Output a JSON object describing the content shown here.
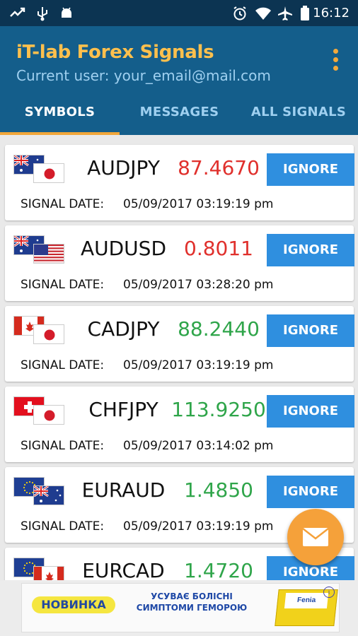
{
  "status_bar": {
    "time": "16:12"
  },
  "app": {
    "title": "iT-lab Forex Signals",
    "subtitle": "Current user: your_email@mail.com"
  },
  "tabs": [
    {
      "label": "SYMBOLS",
      "active": true
    },
    {
      "label": "MESSAGES",
      "active": false
    },
    {
      "label": "ALL SIGNALS",
      "active": false
    }
  ],
  "signal_date_label": "SIGNAL DATE:",
  "ignore_label": "IGNORE",
  "signals": [
    {
      "symbol": "AUDJPY",
      "price": "87.4670",
      "direction_color": "#e0302c",
      "flags": [
        "australia",
        "japan"
      ],
      "date": "05/09/2017 03:19:19 pm"
    },
    {
      "symbol": "AUDUSD",
      "price": "0.8011",
      "direction_color": "#e0302c",
      "flags": [
        "australia",
        "usa"
      ],
      "date": "05/09/2017 03:28:20 pm"
    },
    {
      "symbol": "CADJPY",
      "price": "88.2440",
      "direction_color": "#2fa54a",
      "flags": [
        "canada",
        "japan"
      ],
      "date": "05/09/2017 03:19:19 pm"
    },
    {
      "symbol": "CHFJPY",
      "price": "113.9250",
      "direction_color": "#2fa54a",
      "flags": [
        "switzerland",
        "japan"
      ],
      "date": "05/09/2017 03:14:02 pm"
    },
    {
      "symbol": "EURAUD",
      "price": "1.4850",
      "direction_color": "#2fa54a",
      "flags": [
        "eu",
        "australia"
      ],
      "date": "05/09/2017 03:19:19 pm"
    },
    {
      "symbol": "EURCAD",
      "price": "1.4720",
      "direction_color": "#2fa54a",
      "flags": [
        "eu",
        "canada"
      ],
      "date": ""
    }
  ],
  "ad": {
    "badge": "НОВИНКА",
    "line1": "УСУВАЄ БОЛІСНІ",
    "line2": "СИМПТОМИ ГЕМОРОЮ",
    "product": "Fenia"
  },
  "colors": {
    "app_bar": "#145e8b",
    "status_bar": "#0c3452",
    "title": "#ffc04d",
    "accent": "#f0a63a",
    "button": "#2f8fdf",
    "price_down": "#e0302c",
    "price_up": "#2fa54a"
  }
}
